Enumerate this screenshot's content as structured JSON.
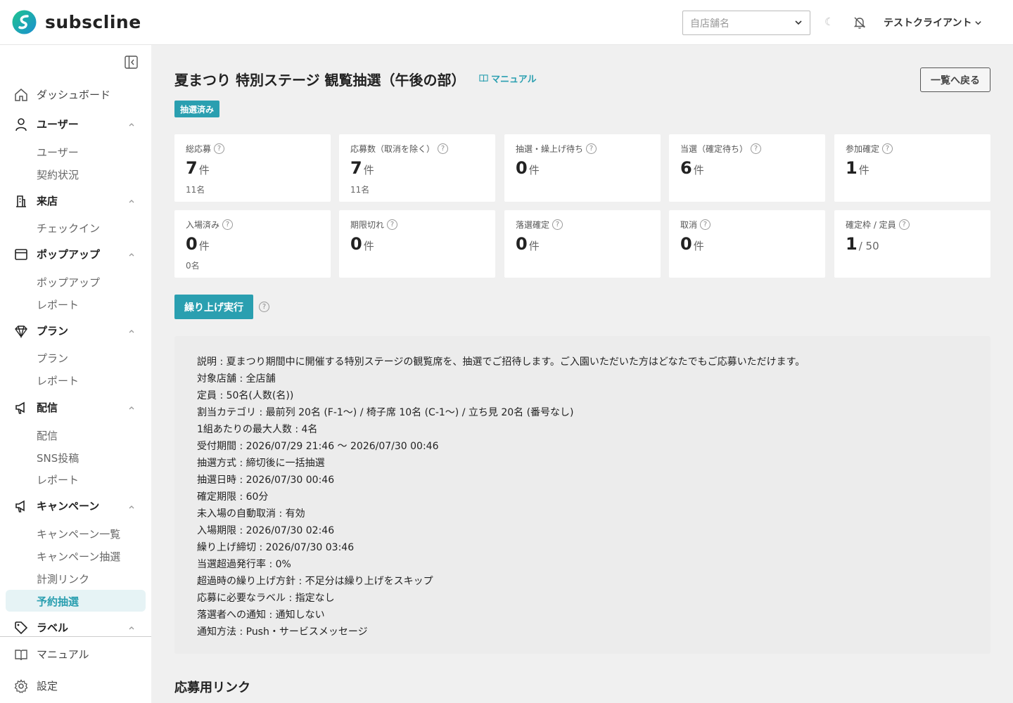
{
  "header": {
    "brand": "subscline",
    "store_placeholder": "自店舗名",
    "moon": "☾",
    "account": "テストクライアント"
  },
  "colors": {
    "accent": "#2a9fb0",
    "logo_green": "#1fc48e",
    "logo_blue": "#1b8fd1"
  },
  "sidebar": {
    "dashboard": "ダッシュボード",
    "groups": {
      "users": {
        "label": "ユーザー",
        "items": [
          "ユーザー",
          "契約状況"
        ]
      },
      "visit": {
        "label": "来店",
        "items": [
          "チェックイン"
        ]
      },
      "popup": {
        "label": "ポップアップ",
        "items": [
          "ポップアップ",
          "レポート"
        ]
      },
      "plan": {
        "label": "プラン",
        "items": [
          "プラン",
          "レポート"
        ]
      },
      "delivery": {
        "label": "配信",
        "items": [
          "配信",
          "SNS投稿",
          "レポート"
        ]
      },
      "campaign": {
        "label": "キャンペーン",
        "items": [
          "キャンペーン一覧",
          "キャンペーン抽選",
          "計測リンク",
          "予約抽選"
        ]
      },
      "label": {
        "label": "ラベル"
      }
    },
    "manual": "マニュアル",
    "settings": "設定"
  },
  "page": {
    "title": "夏まつり 特別ステージ 観覧抽選（午後の部）",
    "manual": "マニュアル",
    "back": "一覧へ戻る",
    "status": "抽選済み",
    "promote": "繰り上げ実行",
    "section_links": "応募用リンク",
    "help": "?"
  },
  "stats": [
    {
      "label": "総応募",
      "value": "7",
      "unit": "件",
      "sub": "11名"
    },
    {
      "label": "応募数（取消を除く）",
      "value": "7",
      "unit": "件",
      "sub": "11名"
    },
    {
      "label": "抽選・繰上げ待ち",
      "value": "0",
      "unit": "件",
      "sub": ""
    },
    {
      "label": "当選（確定待ち）",
      "value": "6",
      "unit": "件",
      "sub": ""
    },
    {
      "label": "参加確定",
      "value": "1",
      "unit": "件",
      "sub": ""
    },
    {
      "label": "入場済み",
      "value": "0",
      "unit": "件",
      "sub": "0名"
    },
    {
      "label": "期限切れ",
      "value": "0",
      "unit": "件",
      "sub": ""
    },
    {
      "label": "落選確定",
      "value": "0",
      "unit": "件",
      "sub": ""
    },
    {
      "label": "取消",
      "value": "0",
      "unit": "件",
      "sub": ""
    },
    {
      "label": "確定枠 / 定員",
      "value": "1",
      "unit": "/ 50",
      "sub": ""
    }
  ],
  "description": [
    "説明 : 夏まつり期間中に開催する特別ステージの観覧席を、抽選でご招待します。ご入園いただいた方はどなたでもご応募いただけます。",
    "対象店舗 : 全店舗",
    "定員 : 50名(人数(名))",
    "割当カテゴリ : 最前列 20名 (F-1〜) / 椅子席 10名 (C-1〜) / 立ち見 20名 (番号なし)",
    "1組あたりの最大人数 : 4名",
    "受付期間 : 2026/07/29 21:46 〜 2026/07/30 00:46",
    "抽選方式 : 締切後に一括抽選",
    "抽選日時 : 2026/07/30 00:46",
    "確定期限 : 60分",
    "未入場の自動取消 : 有効",
    "入場期限 : 2026/07/30 02:46",
    "繰り上げ締切 : 2026/07/30 03:46",
    "当選超過発行率 : 0%",
    "超過時の繰り上げ方針 : 不足分は繰り上げをスキップ",
    "応募に必要なラベル : 指定なし",
    "落選者への通知 : 通知しない",
    "通知方法 : Push・サービスメッセージ"
  ]
}
